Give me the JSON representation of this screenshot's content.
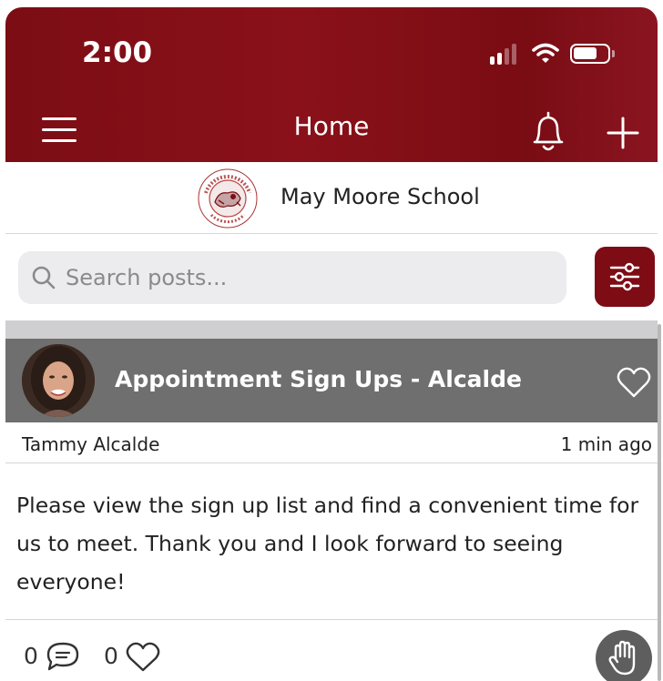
{
  "status_bar": {
    "time": "2:00",
    "signal_bars_active": 2,
    "battery_level": 0.7
  },
  "header": {
    "title": "Home",
    "menu_icon": "hamburger-menu-icon",
    "notification_icon": "bell-icon",
    "add_icon": "plus-icon"
  },
  "school": {
    "name": "May Moore School",
    "logo_text_top": "MAY MOORE PRIMARY SCHOOL",
    "logo_text_bottom": "DEER PARK"
  },
  "search": {
    "placeholder": "Search posts...",
    "value": "",
    "filter_icon": "sliders-icon"
  },
  "post": {
    "title": "Appointment Sign Ups - Alcalde",
    "author": "Tammy Alcalde",
    "timestamp": "1 min ago",
    "body": "Please view the sign up list and find a convenient time for us to meet. Thank you and I look forward to seeing everyone!",
    "comment_count": "0",
    "like_count": "0",
    "favorite_icon": "heart-outline-icon",
    "raise_hand_icon": "raised-hand-icon"
  },
  "colors": {
    "brand": "#7d0c15",
    "post_header_bg": "#6f6f6f",
    "search_bg": "#ececef"
  }
}
